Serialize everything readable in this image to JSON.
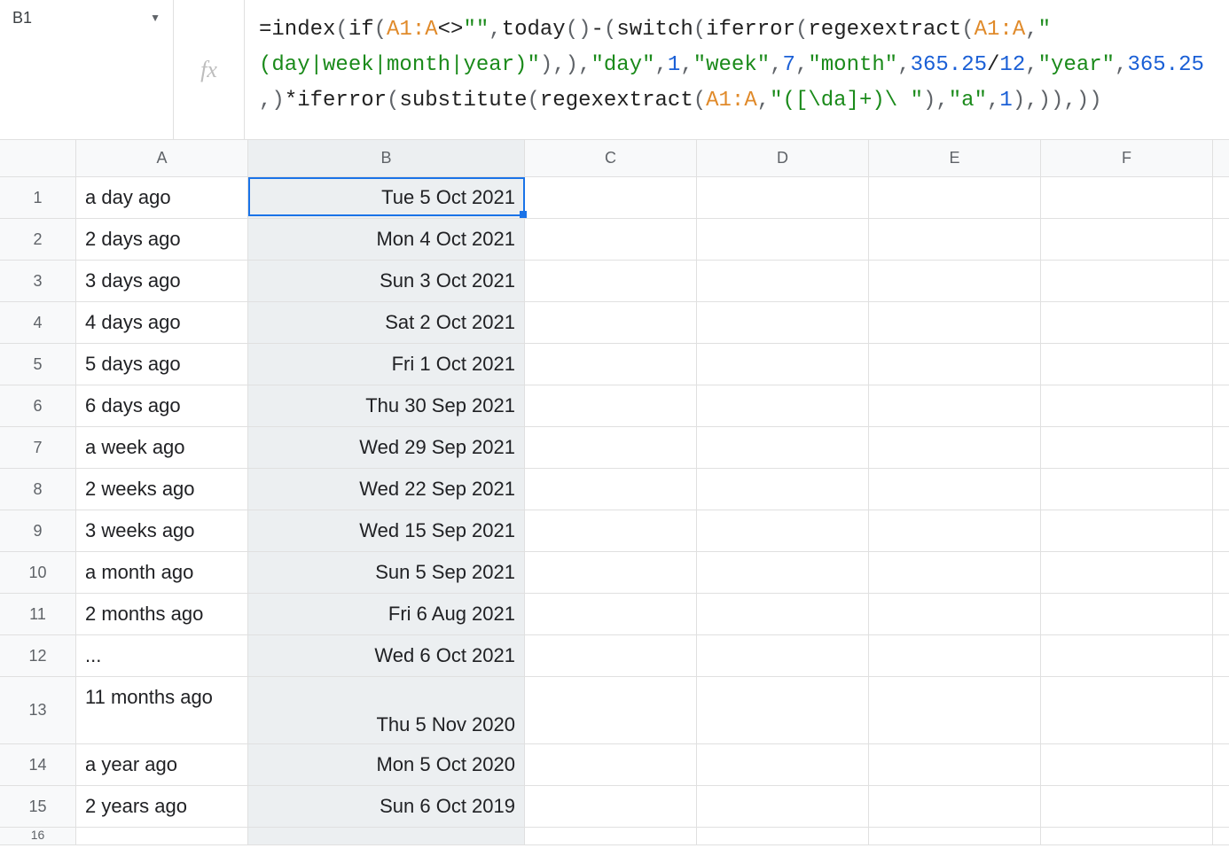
{
  "nameBox": {
    "value": "B1"
  },
  "formula": {
    "tokens": [
      {
        "t": "=",
        "c": ""
      },
      {
        "t": "index",
        "c": ""
      },
      {
        "t": "(",
        "c": "sep"
      },
      {
        "t": "if",
        "c": ""
      },
      {
        "t": "(",
        "c": "sep"
      },
      {
        "t": "A1:A",
        "c": "range"
      },
      {
        "t": "<>",
        "c": ""
      },
      {
        "t": "\"\"",
        "c": "str"
      },
      {
        "t": ",",
        "c": "sep"
      },
      {
        "t": "today",
        "c": ""
      },
      {
        "t": "()",
        "c": "sep"
      },
      {
        "t": "-",
        "c": ""
      },
      {
        "t": "(",
        "c": "sep"
      },
      {
        "t": "switch",
        "c": ""
      },
      {
        "t": "(",
        "c": "sep"
      },
      {
        "t": "iferror",
        "c": ""
      },
      {
        "t": "(",
        "c": "sep"
      },
      {
        "t": "regexextract",
        "c": ""
      },
      {
        "t": "(",
        "c": "sep"
      },
      {
        "t": "A1:A",
        "c": "range"
      },
      {
        "t": ",",
        "c": "sep"
      },
      {
        "t": "\"(day|week|month|year)\"",
        "c": "str"
      },
      {
        "t": ")",
        "c": "sep"
      },
      {
        "t": ",",
        "c": "sep"
      },
      {
        "t": ")",
        "c": "sep"
      },
      {
        "t": ",",
        "c": "sep"
      },
      {
        "t": "\"day\"",
        "c": "str"
      },
      {
        "t": ",",
        "c": "sep"
      },
      {
        "t": "1",
        "c": "num"
      },
      {
        "t": ",",
        "c": "sep"
      },
      {
        "t": "\"week\"",
        "c": "str"
      },
      {
        "t": ",",
        "c": "sep"
      },
      {
        "t": "7",
        "c": "num"
      },
      {
        "t": ",",
        "c": "sep"
      },
      {
        "t": "\"month\"",
        "c": "str"
      },
      {
        "t": ",",
        "c": "sep"
      },
      {
        "t": "365.25",
        "c": "num"
      },
      {
        "t": "/",
        "c": ""
      },
      {
        "t": "12",
        "c": "num"
      },
      {
        "t": ",",
        "c": "sep"
      },
      {
        "t": "\"year\"",
        "c": "str"
      },
      {
        "t": ",",
        "c": "sep"
      },
      {
        "t": "365.25",
        "c": "num"
      },
      {
        "t": ",",
        "c": "sep"
      },
      {
        "t": ")",
        "c": "sep"
      },
      {
        "t": "*",
        "c": ""
      },
      {
        "t": "iferror",
        "c": ""
      },
      {
        "t": "(",
        "c": "sep"
      },
      {
        "t": "substitute",
        "c": ""
      },
      {
        "t": "(",
        "c": "sep"
      },
      {
        "t": "regexextract",
        "c": ""
      },
      {
        "t": "(",
        "c": "sep"
      },
      {
        "t": "A1:A",
        "c": "range"
      },
      {
        "t": ",",
        "c": "sep"
      },
      {
        "t": "\"([\\da]+)\\ \"",
        "c": "str"
      },
      {
        "t": ")",
        "c": "sep"
      },
      {
        "t": ",",
        "c": "sep"
      },
      {
        "t": "\"a\"",
        "c": "str"
      },
      {
        "t": ",",
        "c": "sep"
      },
      {
        "t": "1",
        "c": "num"
      },
      {
        "t": ")",
        "c": "sep"
      },
      {
        "t": ",",
        "c": "sep"
      },
      {
        "t": ")",
        "c": "sep"
      },
      {
        "t": ")",
        "c": "sep"
      },
      {
        "t": ",",
        "c": "sep"
      },
      {
        "t": ")",
        "c": "sep"
      },
      {
        "t": ")",
        "c": "sep"
      }
    ]
  },
  "columns": [
    "A",
    "B",
    "C",
    "D",
    "E",
    "F"
  ],
  "rows": [
    {
      "n": "1",
      "a": "a day ago",
      "b": "Tue 5 Oct 2021"
    },
    {
      "n": "2",
      "a": "2 days ago",
      "b": "Mon 4 Oct 2021"
    },
    {
      "n": "3",
      "a": "3 days ago",
      "b": "Sun 3 Oct 2021"
    },
    {
      "n": "4",
      "a": "4 days ago",
      "b": "Sat 2 Oct 2021"
    },
    {
      "n": "5",
      "a": "5 days ago",
      "b": "Fri 1 Oct 2021"
    },
    {
      "n": "6",
      "a": "6 days ago",
      "b": "Thu 30 Sep 2021"
    },
    {
      "n": "7",
      "a": "a week ago",
      "b": "Wed 29 Sep 2021"
    },
    {
      "n": "8",
      "a": "2 weeks ago",
      "b": "Wed 22 Sep 2021"
    },
    {
      "n": "9",
      "a": "3 weeks ago",
      "b": "Wed 15 Sep 2021"
    },
    {
      "n": "10",
      "a": "a month ago",
      "b": "Sun 5 Sep 2021"
    },
    {
      "n": "11",
      "a": "2 months ago",
      "b": "Fri 6 Aug 2021"
    },
    {
      "n": "12",
      "a": "...",
      "b": "Wed 6 Oct 2021"
    },
    {
      "n": "13",
      "a": "11 months ago",
      "b": "Thu 5 Nov 2020",
      "tall": true
    },
    {
      "n": "14",
      "a": "a year ago",
      "b": "Mon 5 Oct 2020"
    },
    {
      "n": "15",
      "a": "2 years ago",
      "b": "Sun 6 Oct 2019"
    }
  ],
  "extraRow": {
    "n": "16",
    "a": "",
    "b": ""
  }
}
